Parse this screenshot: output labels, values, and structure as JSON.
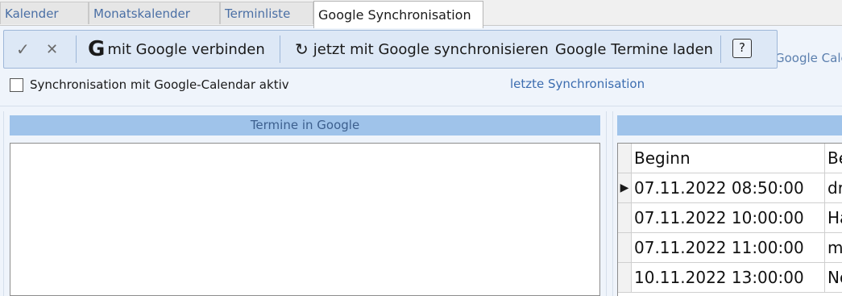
{
  "tabs": [
    {
      "label": "Kalender"
    },
    {
      "label": "Monatskalender"
    },
    {
      "label": "Terminliste"
    },
    {
      "label": "Google Synchronisation"
    }
  ],
  "toolbar": {
    "check_icon": "✓",
    "cancel_icon": "✕",
    "g_icon": "G",
    "connect_label": "mit Google verbinden",
    "refresh_icon": "↻",
    "sync_label": "jetzt mit Google synchronisieren",
    "load_label": "Google Termine laden",
    "help_label": "?"
  },
  "clipped_label": "Google Cale",
  "sync_checkbox": {
    "label": "Synchronisation mit Google-Calendar aktiv",
    "checked": false
  },
  "last_sync_label": "letzte Synchronisation",
  "left_panel": {
    "title": "Termine in Google"
  },
  "grid": {
    "columns": [
      "Beginn",
      "Be"
    ],
    "rows": [
      {
        "indicator": "▶",
        "begin": "07.11.2022 08:50:00",
        "be": "dr"
      },
      {
        "indicator": "",
        "begin": "07.11.2022 10:00:00",
        "be": "Ha"
      },
      {
        "indicator": "",
        "begin": "07.11.2022 11:00:00",
        "be": "m"
      },
      {
        "indicator": "",
        "begin": "10.11.2022 13:00:00",
        "be": "No"
      }
    ]
  },
  "colors": {
    "accent": "#9fc3ea",
    "toolbar_bg": "#dde8f6",
    "link_blue": "#3c6db0"
  }
}
